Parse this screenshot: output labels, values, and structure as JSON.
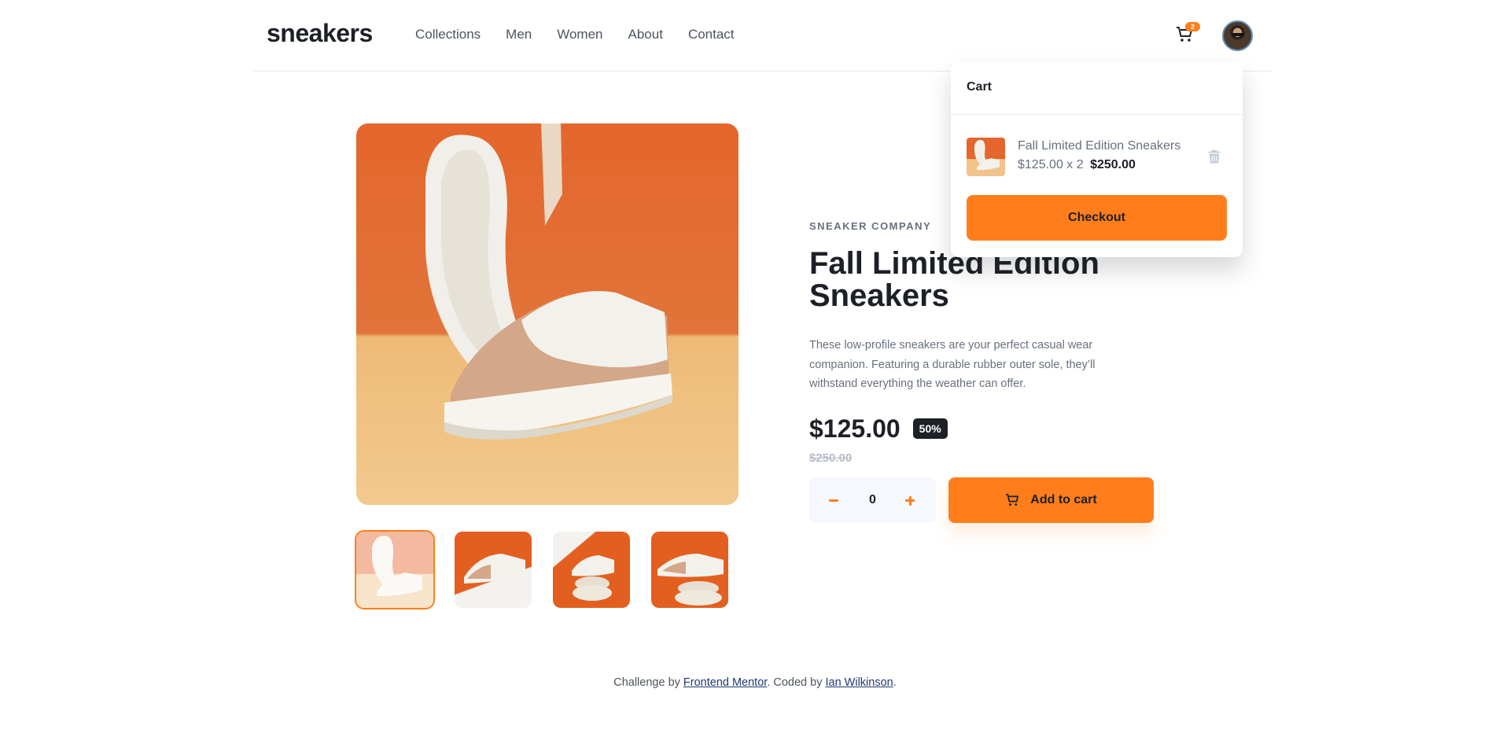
{
  "header": {
    "logo": "sneakers",
    "nav": [
      "Collections",
      "Men",
      "Women",
      "About",
      "Contact"
    ],
    "cart_count": "2"
  },
  "product": {
    "company": "SNEAKER COMPANY",
    "title": "Fall Limited Edition Sneakers",
    "description": "These low-profile sneakers are your perfect casual wear companion. Featuring a durable rubber outer sole, they’ll withstand everything the weather can offer.",
    "price": "$125.00",
    "discount": "50%",
    "old_price": "$250.00",
    "quantity": "0",
    "add_to_cart_label": "Add to cart"
  },
  "cart": {
    "title": "Cart",
    "item_name": "Fall Limited Edition Sneakers",
    "item_unit": "$125.00 x 2",
    "item_total": "$250.00",
    "checkout_label": "Checkout"
  },
  "footer": {
    "prefix": "Challenge by ",
    "link1": "Frontend Mentor",
    "middle": ". Coded by ",
    "link2": "Ian Wilkinson",
    "suffix": "."
  },
  "colors": {
    "accent": "#ff7e1b",
    "dark": "#1d2026",
    "muted": "#68707d",
    "light_bg": "#f6f8fd"
  },
  "icons": [
    "cart-icon",
    "avatar",
    "minus-icon",
    "plus-icon",
    "trash-icon"
  ]
}
